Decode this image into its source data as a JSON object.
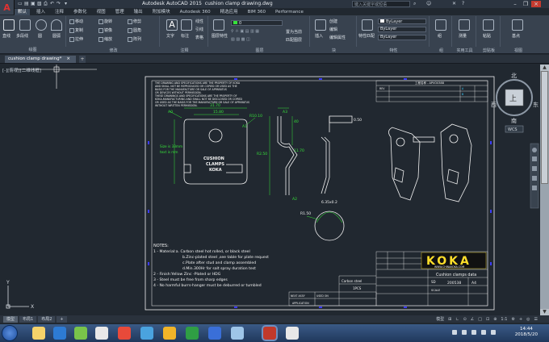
{
  "titlebar": {
    "app_title": "Autodesk AutoCAD 2015",
    "file_title": "cushion clamp drawing.dwg",
    "search_placeholder": "键入关键字或短语"
  },
  "ribbon_tabs": [
    "默认",
    "插入",
    "注释",
    "参数化",
    "视图",
    "管理",
    "输出",
    "附加模块",
    "Autodesk 360",
    "精选应用",
    "BIM 360",
    "Performance"
  ],
  "ribbon_groups": {
    "draw": {
      "label": "绘图",
      "tools": [
        "直线",
        "多段线",
        "圆",
        "圆弧"
      ]
    },
    "modify": {
      "label": "修改",
      "tools": [
        "移动",
        "旋转",
        "修剪",
        "复制",
        "镜像",
        "圆角",
        "拉伸",
        "缩放",
        "阵列"
      ]
    },
    "annotation": {
      "label": "注释",
      "tools": [
        "文字",
        "标注",
        "线性",
        "引线",
        "表格"
      ]
    },
    "layers": {
      "label": "图层",
      "tools": [
        "图层特性",
        "置为当前",
        "匹配图层"
      ],
      "current_layer": "0"
    },
    "block": {
      "label": "块",
      "tools": [
        "插入",
        "创建",
        "编辑",
        "编辑属性"
      ]
    },
    "properties": {
      "label": "特性",
      "tools": [
        "特性匹配",
        "ByLayer",
        "ByLayer",
        "ByLayer"
      ],
      "color": "ByLayer"
    },
    "groups": {
      "label": "组",
      "tools": [
        "组"
      ]
    },
    "utilities": {
      "label": "实用工具",
      "tools": [
        "测量"
      ]
    },
    "clipboard": {
      "label": "剪贴板",
      "tools": [
        "粘贴"
      ]
    },
    "view": {
      "label": "视图",
      "tools": [
        "基点"
      ]
    }
  },
  "doc_tab": {
    "label": "cushion clamp drawing*"
  },
  "viewport_label": "[-][俯视][二维线框]",
  "viewcube": {
    "top": "上",
    "north": "北",
    "south": "南",
    "east": "东",
    "west": "西",
    "wcs": "WCS"
  },
  "drawing": {
    "header_text_lines": [
      "THE DRAWING AND SPECIFICATIONS ARE THE PROPERTY OF KOKA",
      "AND SHALL NOT BE REPRODUCED OR COPIED OR USED AS THE",
      "BASIS FOR THE MANUFACTURE OR SALE OF APPARATUS",
      "OR DEVICES WITHOUT PERMISSION.",
      "THESE DRAWINGS AND SPECIFICATIONS ARE THE PROPERTY OF",
      "KOKA-MANUFACTURING AND SHALL NOT BE DISCLOSED OR COPIED",
      "OR USED AS THE BASIS FOR THE MANUFACTURE OR SALE OF APPARATUS",
      "WITHOUT WRITTEN PERMISSION."
    ],
    "revision_header": "工程名称 - APVO0388",
    "revision_labels": [
      "REV",
      "A",
      "B"
    ],
    "dims": [
      "31.70",
      "15.80",
      "R10.10",
      "40",
      "0.50",
      "R2.50",
      "R1.50",
      "11.70",
      "A2",
      "R1.50",
      "6.35x0.2",
      "A3",
      "A1",
      "A0"
    ],
    "stamp_lines": [
      "CUSHION",
      "CLAMPS",
      "KOKA"
    ],
    "note_text": "Size is 33mm",
    "note_text2": "text is mm",
    "notes_title": "NOTES:",
    "notes": [
      "1 - Material:a. Carbon steel hot rolled, or black steel",
      "b.Zinc-plated steel ,see table for plate request",
      "c.Plate after stud and clamp assembled",
      "d.Min.300Hr for salt spray duration test",
      "2 - Finish:Yellow Zinc -Plated or HDG",
      "3 - Steel must be free from sharp edges",
      "4 - No harmful burrs-hanger must be deburred or tumbled"
    ],
    "koka_logo": "KOKA",
    "koka_url": "WWW.CHINAKOKA.COM",
    "title_block": {
      "title": "Cushion clamps data",
      "drawing_no": "200538",
      "scale_label": "SCALE",
      "size": "A4",
      "size_label": "SD",
      "material_label": "Carbon steel",
      "qty": "1PCS",
      "next_assy": "NEXT ASSY",
      "used_on": "USED ON",
      "application": "APPLICATION"
    }
  },
  "layout_tabs": [
    "模型",
    "布局1",
    "布局2"
  ],
  "status": [
    "模型",
    "⊞",
    "∟",
    "⊙",
    "∠",
    "□",
    "⊡",
    "⊕",
    "1:1",
    "⚙",
    "+",
    "◎",
    "☰"
  ],
  "taskbar": {
    "time": "14:44",
    "date": "2018/5/20"
  },
  "colors": {
    "model_bg": "#212830",
    "ribbon_bg": "#38424f",
    "drawing_white": "#f2f2f2",
    "drawing_green": "#36e33a",
    "accent_yellow": "#ffde2a",
    "blue_marker": "#3b3bff"
  }
}
